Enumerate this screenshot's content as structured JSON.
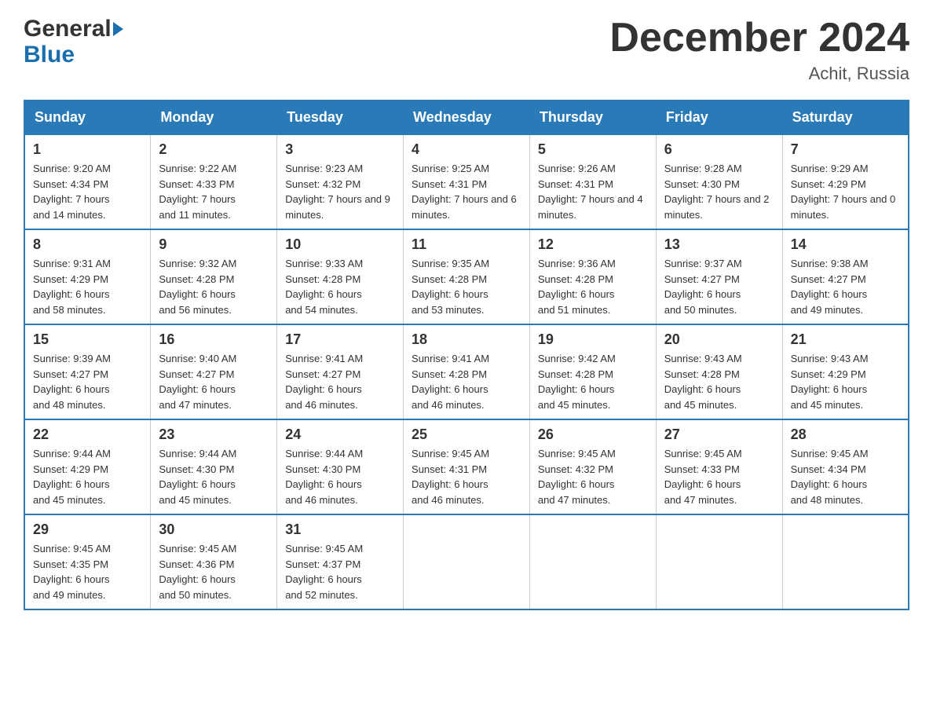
{
  "header": {
    "logo_general": "General",
    "logo_blue": "Blue",
    "month_title": "December 2024",
    "location": "Achit, Russia"
  },
  "weekdays": [
    "Sunday",
    "Monday",
    "Tuesday",
    "Wednesday",
    "Thursday",
    "Friday",
    "Saturday"
  ],
  "weeks": [
    [
      {
        "day": "1",
        "sunrise": "9:20 AM",
        "sunset": "4:34 PM",
        "daylight": "7 hours and 14 minutes."
      },
      {
        "day": "2",
        "sunrise": "9:22 AM",
        "sunset": "4:33 PM",
        "daylight": "7 hours and 11 minutes."
      },
      {
        "day": "3",
        "sunrise": "9:23 AM",
        "sunset": "4:32 PM",
        "daylight": "7 hours and 9 minutes."
      },
      {
        "day": "4",
        "sunrise": "9:25 AM",
        "sunset": "4:31 PM",
        "daylight": "7 hours and 6 minutes."
      },
      {
        "day": "5",
        "sunrise": "9:26 AM",
        "sunset": "4:31 PM",
        "daylight": "7 hours and 4 minutes."
      },
      {
        "day": "6",
        "sunrise": "9:28 AM",
        "sunset": "4:30 PM",
        "daylight": "7 hours and 2 minutes."
      },
      {
        "day": "7",
        "sunrise": "9:29 AM",
        "sunset": "4:29 PM",
        "daylight": "7 hours and 0 minutes."
      }
    ],
    [
      {
        "day": "8",
        "sunrise": "9:31 AM",
        "sunset": "4:29 PM",
        "daylight": "6 hours and 58 minutes."
      },
      {
        "day": "9",
        "sunrise": "9:32 AM",
        "sunset": "4:28 PM",
        "daylight": "6 hours and 56 minutes."
      },
      {
        "day": "10",
        "sunrise": "9:33 AM",
        "sunset": "4:28 PM",
        "daylight": "6 hours and 54 minutes."
      },
      {
        "day": "11",
        "sunrise": "9:35 AM",
        "sunset": "4:28 PM",
        "daylight": "6 hours and 53 minutes."
      },
      {
        "day": "12",
        "sunrise": "9:36 AM",
        "sunset": "4:28 PM",
        "daylight": "6 hours and 51 minutes."
      },
      {
        "day": "13",
        "sunrise": "9:37 AM",
        "sunset": "4:27 PM",
        "daylight": "6 hours and 50 minutes."
      },
      {
        "day": "14",
        "sunrise": "9:38 AM",
        "sunset": "4:27 PM",
        "daylight": "6 hours and 49 minutes."
      }
    ],
    [
      {
        "day": "15",
        "sunrise": "9:39 AM",
        "sunset": "4:27 PM",
        "daylight": "6 hours and 48 minutes."
      },
      {
        "day": "16",
        "sunrise": "9:40 AM",
        "sunset": "4:27 PM",
        "daylight": "6 hours and 47 minutes."
      },
      {
        "day": "17",
        "sunrise": "9:41 AM",
        "sunset": "4:27 PM",
        "daylight": "6 hours and 46 minutes."
      },
      {
        "day": "18",
        "sunrise": "9:41 AM",
        "sunset": "4:28 PM",
        "daylight": "6 hours and 46 minutes."
      },
      {
        "day": "19",
        "sunrise": "9:42 AM",
        "sunset": "4:28 PM",
        "daylight": "6 hours and 45 minutes."
      },
      {
        "day": "20",
        "sunrise": "9:43 AM",
        "sunset": "4:28 PM",
        "daylight": "6 hours and 45 minutes."
      },
      {
        "day": "21",
        "sunrise": "9:43 AM",
        "sunset": "4:29 PM",
        "daylight": "6 hours and 45 minutes."
      }
    ],
    [
      {
        "day": "22",
        "sunrise": "9:44 AM",
        "sunset": "4:29 PM",
        "daylight": "6 hours and 45 minutes."
      },
      {
        "day": "23",
        "sunrise": "9:44 AM",
        "sunset": "4:30 PM",
        "daylight": "6 hours and 45 minutes."
      },
      {
        "day": "24",
        "sunrise": "9:44 AM",
        "sunset": "4:30 PM",
        "daylight": "6 hours and 46 minutes."
      },
      {
        "day": "25",
        "sunrise": "9:45 AM",
        "sunset": "4:31 PM",
        "daylight": "6 hours and 46 minutes."
      },
      {
        "day": "26",
        "sunrise": "9:45 AM",
        "sunset": "4:32 PM",
        "daylight": "6 hours and 47 minutes."
      },
      {
        "day": "27",
        "sunrise": "9:45 AM",
        "sunset": "4:33 PM",
        "daylight": "6 hours and 47 minutes."
      },
      {
        "day": "28",
        "sunrise": "9:45 AM",
        "sunset": "4:34 PM",
        "daylight": "6 hours and 48 minutes."
      }
    ],
    [
      {
        "day": "29",
        "sunrise": "9:45 AM",
        "sunset": "4:35 PM",
        "daylight": "6 hours and 49 minutes."
      },
      {
        "day": "30",
        "sunrise": "9:45 AM",
        "sunset": "4:36 PM",
        "daylight": "6 hours and 50 minutes."
      },
      {
        "day": "31",
        "sunrise": "9:45 AM",
        "sunset": "4:37 PM",
        "daylight": "6 hours and 52 minutes."
      },
      null,
      null,
      null,
      null
    ]
  ],
  "labels": {
    "sunrise": "Sunrise:",
    "sunset": "Sunset:",
    "daylight": "Daylight:"
  }
}
